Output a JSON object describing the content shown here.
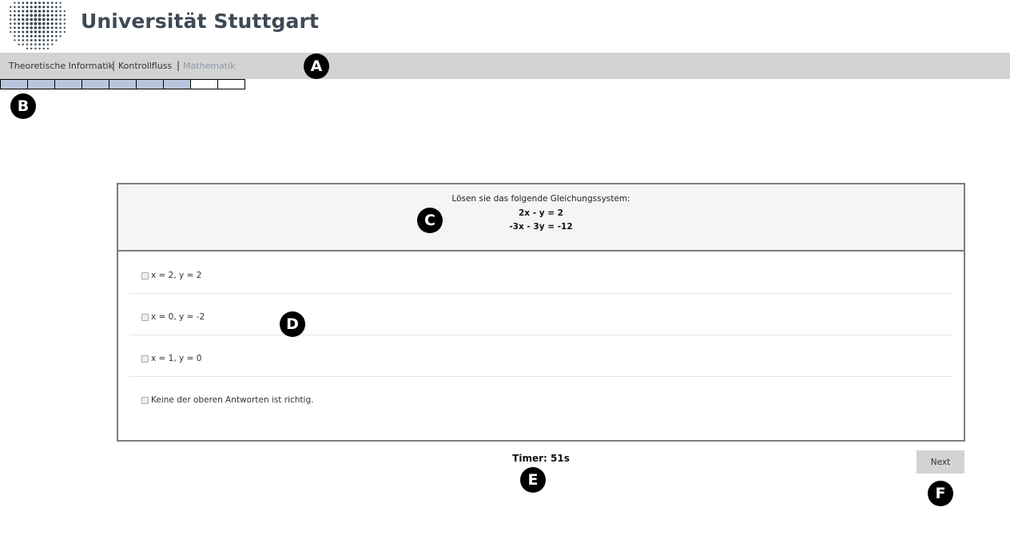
{
  "header": {
    "university_name": "Universität Stuttgart"
  },
  "nav": {
    "items": [
      {
        "label": "Theoretische Informatik",
        "active": false
      },
      {
        "label": "Kontrollfluss",
        "active": false
      },
      {
        "label": "Mathematik",
        "active": true
      }
    ],
    "separator": "|"
  },
  "progress": {
    "completed": 7,
    "total": 9,
    "fill_color": "#b8c6dd"
  },
  "markers": [
    "A",
    "B",
    "C",
    "D",
    "E",
    "F"
  ],
  "question": {
    "prompt": "Lösen sie das folgende Gleichungssystem:",
    "equations": [
      "2x - y = 2",
      "-3x - 3y = -12"
    ]
  },
  "answers": [
    {
      "label": "x = 2, y = 2",
      "checked": false
    },
    {
      "label": "x = 0, y = -2",
      "checked": false
    },
    {
      "label": "x = 1, y = 0",
      "checked": false
    },
    {
      "label": "Keine der oberen Antworten ist richtig.",
      "checked": false
    }
  ],
  "timer": {
    "text": "Timer: 51s"
  },
  "controls": {
    "next_label": "Next"
  }
}
